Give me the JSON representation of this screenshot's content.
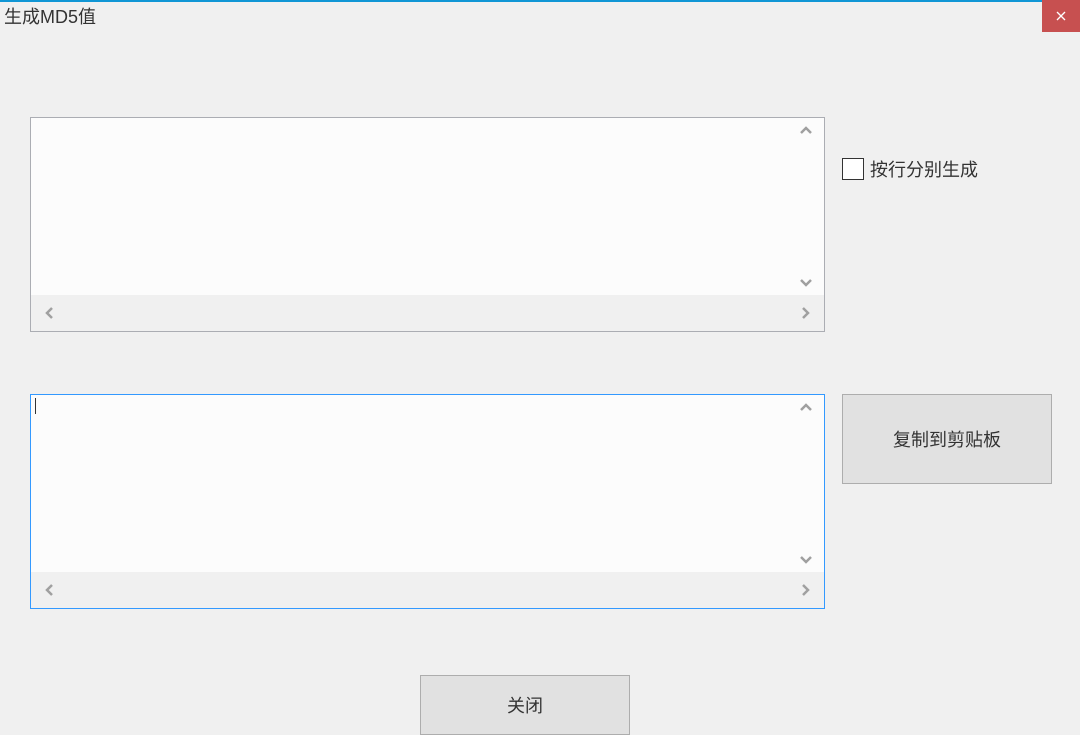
{
  "window": {
    "title": "生成MD5值"
  },
  "input_area": {
    "value": ""
  },
  "output_area": {
    "value": ""
  },
  "options": {
    "per_line_label": "按行分别生成",
    "per_line_checked": false
  },
  "buttons": {
    "copy_label": "复制到剪贴板",
    "close_label": "关闭"
  }
}
